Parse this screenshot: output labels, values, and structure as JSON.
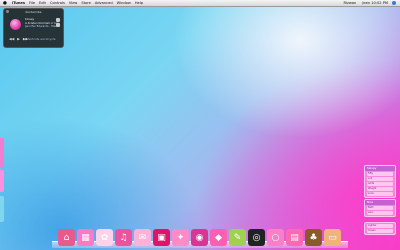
{
  "menubar": {
    "app_name": "iTunes",
    "menus": [
      "File",
      "Edit",
      "Controls",
      "View",
      "Store",
      "Advanced",
      "Window",
      "Help"
    ],
    "user_label": "Rizwan",
    "clock": "Jeen 10:02 PM"
  },
  "widget": {
    "title": "Kontaimba",
    "track_title": "Kinsey",
    "track_line2": "A Kristen Kimmell cr Inco",
    "track_artist": "Jennifer Edwards - Memories",
    "rating_label": "Shortcuts are bicycle"
  },
  "panels": [
    {
      "title": "Sloopy",
      "rows": [
        "Fifty",
        "Lo2",
        "Amts",
        "Weight",
        "Loca"
      ]
    },
    {
      "title": "Nice",
      "rows": [
        "Bath",
        "Aero"
      ]
    },
    {
      "title": "",
      "rows": [
        "Lighter",
        "Ocean"
      ]
    }
  ],
  "dock": {
    "items": [
      {
        "name": "home-icon",
        "glyph": "⌂",
        "color": "#e75b8a"
      },
      {
        "name": "calendar-icon",
        "glyph": "▦",
        "color": "#ff79c6"
      },
      {
        "name": "hello-kitty-icon",
        "glyph": "✿",
        "color": "#ffd1ea"
      },
      {
        "name": "itunes-icon",
        "glyph": "♫",
        "color": "#f0519e"
      },
      {
        "name": "doc-icon",
        "glyph": "✉",
        "color": "#ffb2d9"
      },
      {
        "name": "clapper-icon",
        "glyph": "▣",
        "color": "#e0136b"
      },
      {
        "name": "pinwheel-icon",
        "glyph": "✦",
        "color": "#ff8ac8"
      },
      {
        "name": "pink-circle-icon",
        "glyph": "◉",
        "color": "#d93694"
      },
      {
        "name": "tag-icon",
        "glyph": "◆",
        "color": "#ff5fb0"
      },
      {
        "name": "palette-icon",
        "glyph": "✎",
        "color": "#a0d04f"
      },
      {
        "name": "disc-icon",
        "glyph": "◎",
        "color": "#222222"
      },
      {
        "name": "ring-icon",
        "glyph": "○",
        "color": "#ff7ec7"
      },
      {
        "name": "photo-icon",
        "glyph": "▤",
        "color": "#ff69b4"
      },
      {
        "name": "bear-icon",
        "glyph": "♣",
        "color": "#8b5a2b"
      },
      {
        "name": "folder-icon",
        "glyph": "▭",
        "color": "#f1b37c"
      }
    ]
  },
  "drawer_tabs": [
    {
      "color": "#f27bd4"
    },
    {
      "color": "#ff8fe0"
    },
    {
      "color": "#7ed6f0"
    }
  ]
}
